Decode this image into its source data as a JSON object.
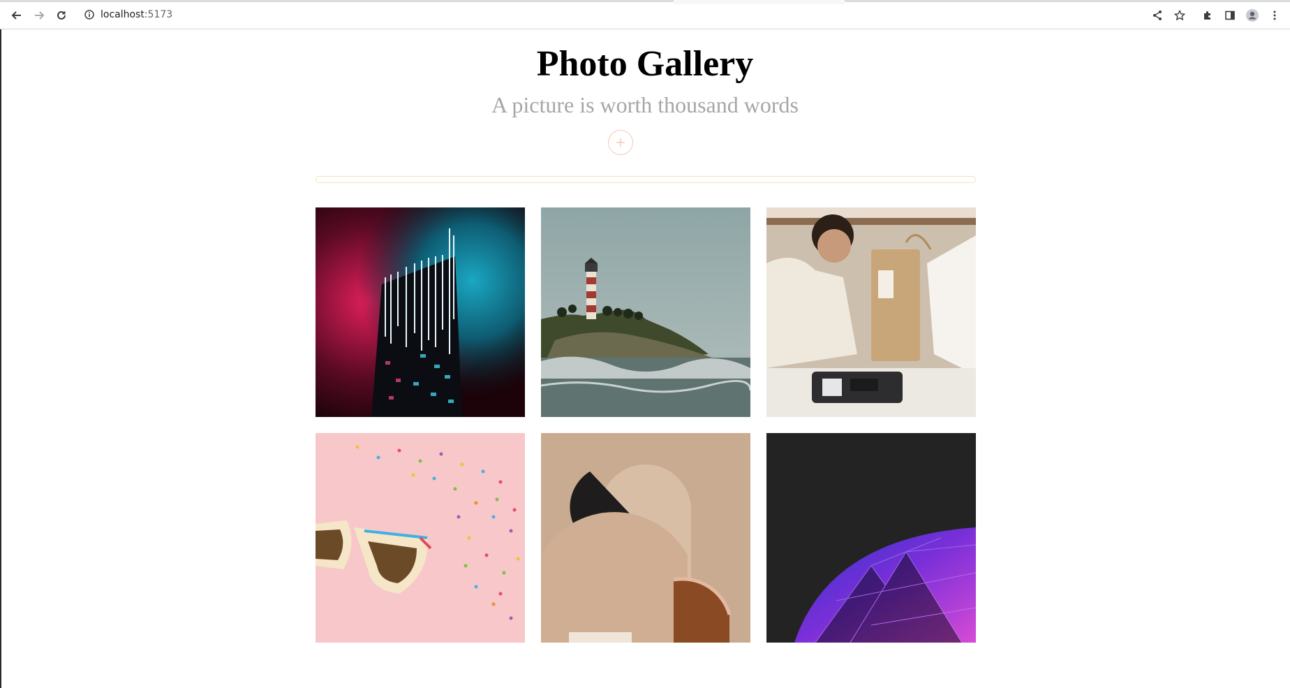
{
  "browser": {
    "url_host": "localhost",
    "url_port": ":5173"
  },
  "header": {
    "title": "Photo Gallery",
    "subtitle": "A picture is worth thousand words"
  },
  "upload": {
    "button_icon": "plus-icon",
    "progress": 0
  },
  "gallery": {
    "photos": [
      {
        "subject": "neon skyscraper"
      },
      {
        "subject": "lighthouse on rocky coast"
      },
      {
        "subject": "shop cashier handing paper bag"
      },
      {
        "subject": "sunglasses with confetti"
      },
      {
        "subject": "abstract paper shapes"
      },
      {
        "subject": "purple geodesic sphere"
      }
    ]
  },
  "colors": {
    "accent_ring": "#f3c9b9",
    "progress_border": "#f2e2bd",
    "subtitle": "#a6a6a6"
  }
}
